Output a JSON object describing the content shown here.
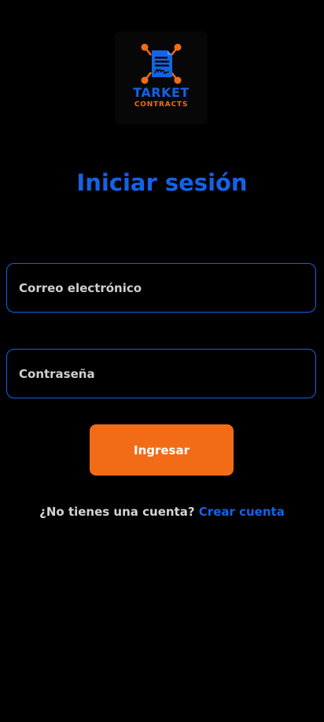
{
  "colors": {
    "background": "#000000",
    "accent_blue": "#1463e6",
    "accent_orange": "#f26c18",
    "text_light": "#d4d4d4",
    "button_text": "#ffffff"
  },
  "logo": {
    "icon": "signed-document-icon",
    "brand_name": "TARKET",
    "brand_sub": "CONTRACTS"
  },
  "title": "Iniciar sesión",
  "form": {
    "email_placeholder": "Correo electrónico",
    "password_placeholder": "Contraseña",
    "submit_label": "Ingresar"
  },
  "signup": {
    "prompt": "¿No tienes una cuenta?",
    "link_label": "Crear cuenta"
  }
}
